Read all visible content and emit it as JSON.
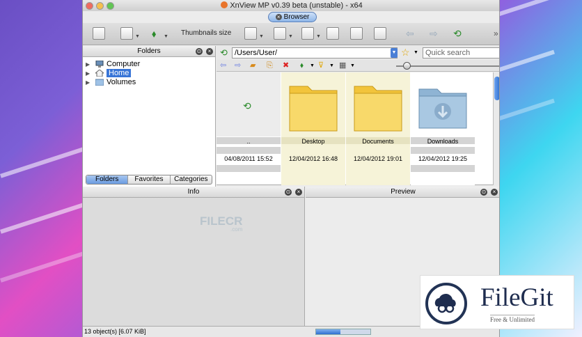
{
  "window": {
    "title": "XnView MP v0.39 beta (unstable) - x64",
    "browser_tab": "Browser"
  },
  "toolbar": {
    "thumbnails_size_label": "Thumbnails size"
  },
  "folders_pane": {
    "title": "Folders",
    "tree": [
      {
        "label": "Computer",
        "icon": "computer-icon"
      },
      {
        "label": "Home",
        "icon": "home-icon",
        "selected": true
      },
      {
        "label": "Volumes",
        "icon": "folder-icon"
      }
    ],
    "tabs": [
      "Folders",
      "Favorites",
      "Categories"
    ]
  },
  "address_bar": {
    "path": "/Users/User/",
    "search_placeholder": "Quick search"
  },
  "files": [
    {
      "name": "..",
      "date": "04/08/2011 15:52",
      "type": "parent"
    },
    {
      "name": "Desktop",
      "date": "12/04/2012 16:48",
      "type": "folder"
    },
    {
      "name": "Documents",
      "date": "12/04/2012 19:01",
      "type": "folder"
    },
    {
      "name": "Downloads",
      "date": "12/04/2012 19:25",
      "type": "downloads-folder"
    }
  ],
  "info_pane": {
    "title": "Info"
  },
  "preview_pane": {
    "title": "Preview"
  },
  "status_bar": {
    "text": "13 object(s) [6.07 KiB]"
  },
  "watermarks": {
    "filecr": "FILECR",
    "filecr_sub": ".com",
    "filegit": "FileGit",
    "filegit_sub": "Free & Unlimited"
  },
  "colors": {
    "selection": "#3875d7",
    "folder_yellow": "#f7d252"
  }
}
